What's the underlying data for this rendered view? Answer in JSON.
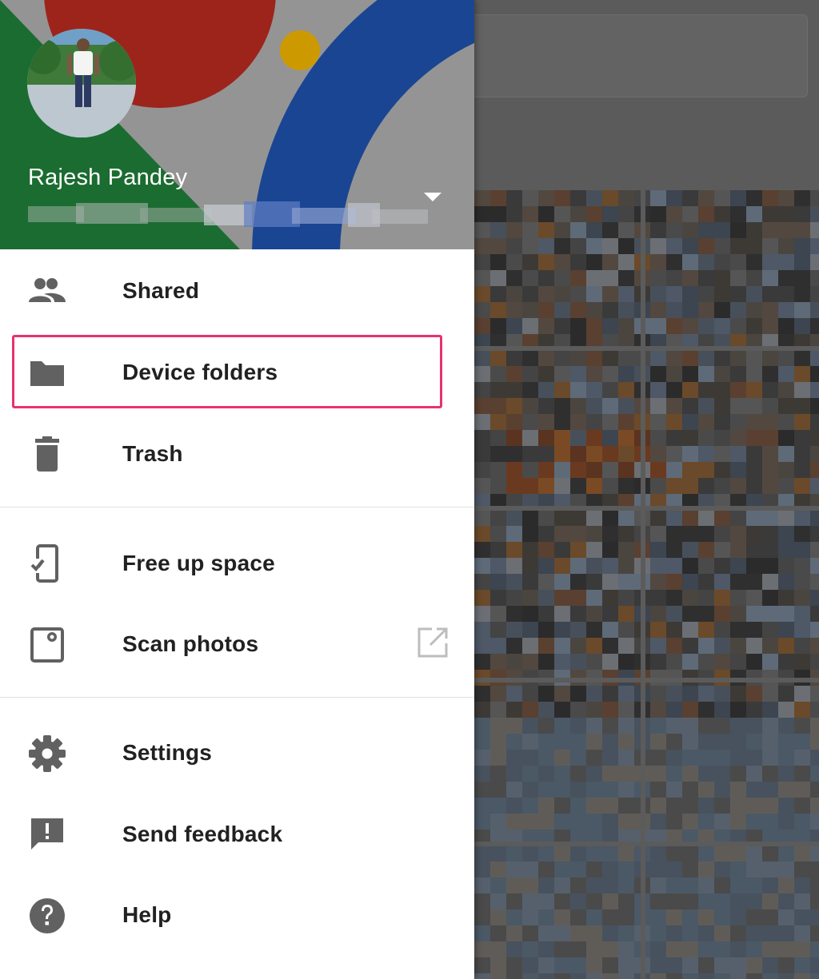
{
  "account": {
    "name": "Rajesh Pandey",
    "email_redacted": true
  },
  "menu": {
    "section1": [
      {
        "label": "Shared",
        "icon": "people-icon"
      },
      {
        "label": "Device folders",
        "icon": "folder-icon",
        "highlighted": true
      },
      {
        "label": "Trash",
        "icon": "trash-icon"
      }
    ],
    "section2": [
      {
        "label": "Free up space",
        "icon": "phone-check-icon"
      },
      {
        "label": "Scan photos",
        "icon": "photoscan-icon",
        "external": true
      }
    ],
    "section3": [
      {
        "label": "Settings",
        "icon": "gear-icon"
      },
      {
        "label": "Send feedback",
        "icon": "feedback-icon"
      },
      {
        "label": "Help",
        "icon": "help-icon"
      }
    ]
  },
  "colors": {
    "highlight": "#e8326e",
    "header_red": "#b3291f",
    "header_blue": "#1d4fa8",
    "header_green": "#1f7b38",
    "header_yellow": "#e9b000",
    "icon_grey": "#616161"
  }
}
